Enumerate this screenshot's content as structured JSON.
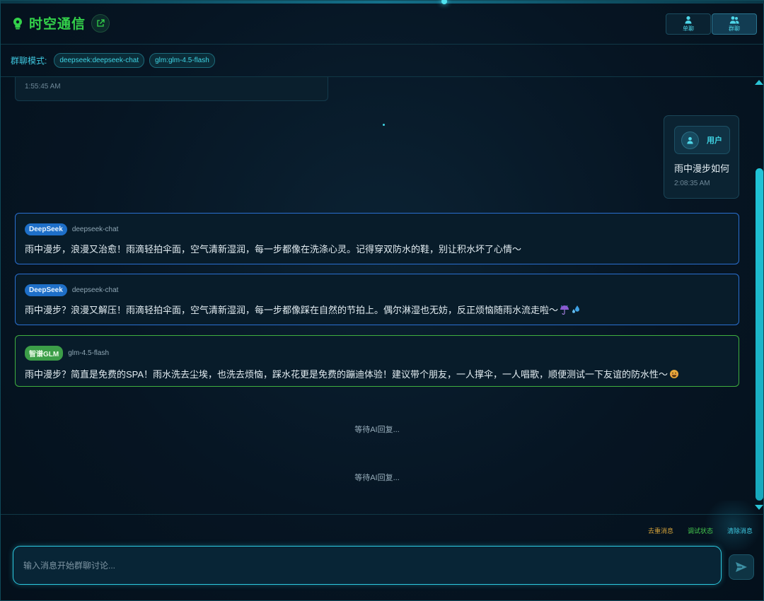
{
  "app": {
    "title": "时空通信",
    "modes": [
      {
        "label": "单聊",
        "icon": "user-icon",
        "active": false
      },
      {
        "label": "群聊",
        "icon": "users-icon",
        "active": true
      }
    ]
  },
  "group_bar": {
    "label": "群聊模式:",
    "models": [
      "deepseek:deepseek-chat",
      "glm:glm-4.5-flash"
    ]
  },
  "messages": {
    "previous_time": "1:55:45 AM",
    "user": {
      "name": "用户",
      "text": "雨中漫步如何",
      "time": "2:08:35 AM"
    },
    "ai": [
      {
        "provider": "DeepSeek",
        "model": "deepseek-chat",
        "text": "雨中漫步，浪漫又治愈！雨滴轻拍伞面，空气清新湿润，每一步都像在洗涤心灵。记得穿双防水的鞋，别让积水坏了心情～"
      },
      {
        "provider": "DeepSeek",
        "model": "deepseek-chat",
        "text": "雨中漫步？浪漫又解压！雨滴轻拍伞面，空气清新湿润，每一步都像踩在自然的节拍上。偶尔淋湿也无妨，反正烦恼随雨水流走啦～",
        "emoji": [
          "umbrella-rain-icon",
          "droplets-icon"
        ]
      },
      {
        "provider": "智谱GLM",
        "model": "glm-4.5-flash",
        "text": "雨中漫步？简直是免费的SPA！雨水洗去尘埃，也洗去烦恼，踩水花更是免费的蹦迪体验！建议带个朋友，一人撑伞，一人唱歌，顺便测试一下友谊的防水性～",
        "emoji": [
          "grin-face-icon"
        ]
      }
    ],
    "waiting": [
      "等待AI回复...",
      "等待AI回复..."
    ]
  },
  "footer": {
    "dedupe": "去重消息",
    "debug": "调试状态",
    "clear": "清除消息",
    "input_placeholder": "输入消息开始群聊讨论...",
    "send_icon": "send-icon"
  },
  "colors": {
    "accent": "#2cc9e0",
    "brand_green": "#33d14a",
    "deepseek_blue": "#1e6fc8",
    "glm_green": "#3c9e48"
  }
}
